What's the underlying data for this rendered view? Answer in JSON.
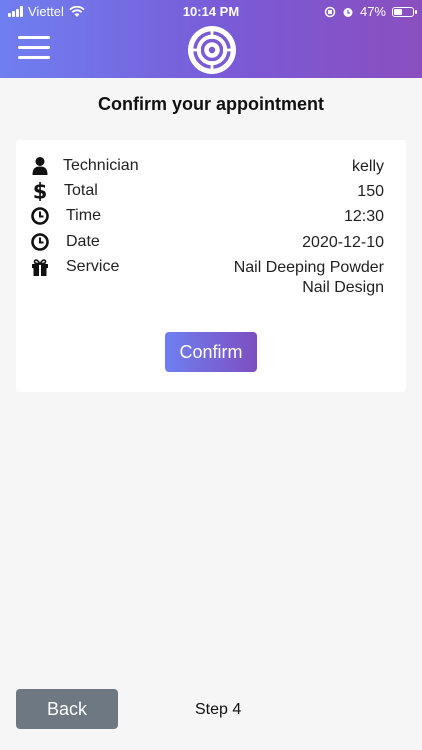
{
  "status_bar": {
    "carrier": "Viettel",
    "time": "10:14 PM",
    "battery": "47%"
  },
  "header": {
    "menu_icon": "hamburger-icon",
    "logo_icon": "target-logo"
  },
  "page": {
    "title": "Confirm your appointment"
  },
  "details": [
    {
      "key": "technician",
      "icon": "user-icon",
      "label": "Technician",
      "value": "kelly"
    },
    {
      "key": "total",
      "icon": "dollar-icon",
      "label": "Total",
      "value": "150"
    },
    {
      "key": "time",
      "icon": "clock-icon",
      "label": "Time",
      "value": "12:30"
    },
    {
      "key": "date",
      "icon": "clock-icon",
      "label": "Date",
      "value": "2020-12-10"
    },
    {
      "key": "service",
      "icon": "gift-icon",
      "label": "Service",
      "value": [
        "Nail Deeping Powder",
        "Nail Design"
      ]
    }
  ],
  "actions": {
    "confirm": "Confirm",
    "back": "Back"
  },
  "footer": {
    "step": "Step 4"
  },
  "colors": {
    "gradient_start": "#6f7ff0",
    "gradient_end": "#8a4fbf",
    "back_button": "#6e7883"
  }
}
